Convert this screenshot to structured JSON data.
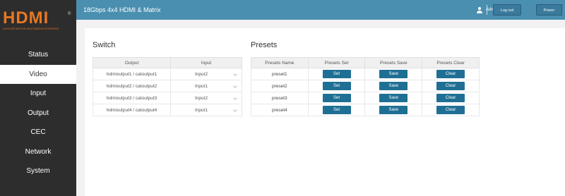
{
  "logo": {
    "text": "HDMI",
    "trademark": "®",
    "tagline": "HIGH-DEFINITION MULTIMEDIA INTERFACE"
  },
  "sidebar": {
    "items": [
      {
        "label": "Status",
        "active": false
      },
      {
        "label": "Video",
        "active": true
      },
      {
        "label": "Input",
        "active": false
      },
      {
        "label": "Output",
        "active": false
      },
      {
        "label": "CEC",
        "active": false
      },
      {
        "label": "Network",
        "active": false
      },
      {
        "label": "System",
        "active": false
      }
    ]
  },
  "header": {
    "title": "18Gbps 4x4 HDMI & Matrix",
    "user": "Admin",
    "logout_label": "Log out",
    "poweron_label": "Power on"
  },
  "switch": {
    "title": "Switch",
    "columns": [
      "Output",
      "Input"
    ],
    "rows": [
      {
        "output": "hdmioutput1 / catoutput1",
        "input": "Input2"
      },
      {
        "output": "hdmioutput2 / catoutput2",
        "input": "Input1"
      },
      {
        "output": "hdmioutput3 / catoutput3",
        "input": "Input2"
      },
      {
        "output": "hdmioutput4 / catoutput4",
        "input": "Input1"
      }
    ]
  },
  "presets": {
    "title": "Presets",
    "columns": [
      "Presets Name",
      "Presets Set",
      "Presets Save",
      "Presets Clear"
    ],
    "set_label": "Set",
    "save_label": "Save",
    "clear_label": "Clear",
    "rows": [
      {
        "name": "preset1"
      },
      {
        "name": "preset2"
      },
      {
        "name": "preset3"
      },
      {
        "name": "preset4"
      }
    ]
  },
  "colors": {
    "topbar": "#4a8fb0",
    "sidebar": "#2d2d2d",
    "button": "#1f6f95",
    "logo": "#e87722"
  }
}
